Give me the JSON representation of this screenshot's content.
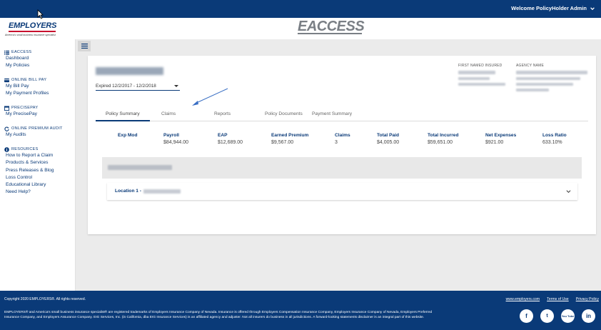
{
  "header": {
    "welcome": "Welcome PolicyHolder Admin",
    "logo_text": "EMPLOYERS",
    "logo_tagline": "America's small business insurance specialist",
    "app_title": "EACCESS"
  },
  "sidebar": {
    "sections": [
      {
        "heading": "EACCESS",
        "icon": "list-icon",
        "links": [
          "Dashboard",
          "My Policies"
        ]
      },
      {
        "heading": "ONLINE BILL PAY",
        "icon": "credit-card-icon",
        "links": [
          "My Bill Pay",
          "My Payment Profiles"
        ]
      },
      {
        "heading": "PRECISEPAY",
        "icon": "calendar-icon",
        "links": [
          "My PrecisePay"
        ]
      },
      {
        "heading": "ONLINE PREMIUM AUDIT",
        "icon": "refresh-icon",
        "links": [
          "My Audits"
        ]
      },
      {
        "heading": "RESOURCES",
        "icon": "info-icon",
        "links": [
          "How to Report a Claim",
          "Products & Services",
          "Press Releases & Blog",
          "Loss Control",
          "Educational Library",
          "Need Help?"
        ]
      }
    ]
  },
  "policy": {
    "term": "Expired 12/2/2017 - 12/2/2018",
    "first_named_insured_label": "FIRST NAMED INSURED",
    "agency_name_label": "AGENCY NAME"
  },
  "tabs": [
    "Policy Summary",
    "Claims",
    "Reports",
    "Policy Documents",
    "Payment Summary"
  ],
  "stats": [
    {
      "label": "Exp Mod",
      "value": ""
    },
    {
      "label": "Payroll",
      "value": "$84,944.00"
    },
    {
      "label": "EAP",
      "value": "$12,689.00"
    },
    {
      "label": "Earned Premium",
      "value": "$9,567.00"
    },
    {
      "label": "Claims",
      "value": "3"
    },
    {
      "label": "Total Paid",
      "value": "$4,005.00"
    },
    {
      "label": "Total Incurred",
      "value": "$59,651.00"
    },
    {
      "label": "Net Expenses",
      "value": "$921.00"
    },
    {
      "label": "Loss Ratio",
      "value": "633.10%"
    }
  ],
  "location": {
    "label": "Location 1 -"
  },
  "footer": {
    "copyright": "Copyright 2020 EMPLOYERS®. All rights reserved.",
    "legal": "EMPLOYERS® and America's small business insurance specialist® are registered trademarks of Employers Insurance Company of Nevada. Insurance is offered through Employers Compensation Insurance Company, Employers Insurance Company of Nevada, Employers Preferred Insurance Company, and Employers Assurance Company. EIG Services, Inc. (in California, dba EIG Insurance Services) is an affiliated agency and adjuster. Not all insurers do business in all jurisdictions. A forward-looking statements disclaimer is an integral part of this website.",
    "links": [
      "www.employers.com",
      "Terms of Use",
      "Privacy Policy"
    ],
    "social": [
      "f",
      "t",
      "You Tube",
      "in"
    ]
  }
}
